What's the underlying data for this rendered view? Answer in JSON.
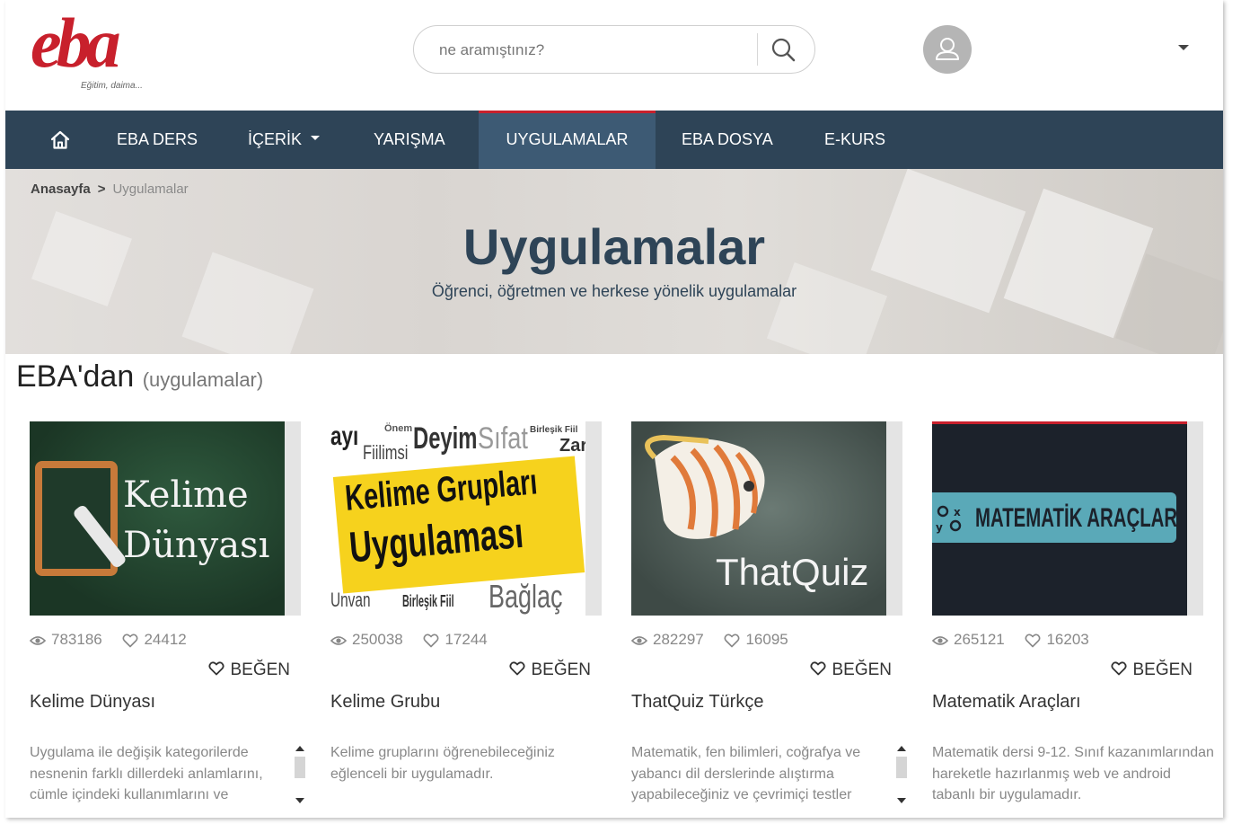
{
  "brand": {
    "logo_text": "eba",
    "tagline": "Eğitim, daima..."
  },
  "search": {
    "placeholder": "ne aramıştınız?"
  },
  "icons": {
    "home": "home-icon",
    "search": "search-icon",
    "user": "user-icon",
    "eye": "eye-icon",
    "heart": "heart-icon"
  },
  "colors": {
    "brand_red": "#c8202c",
    "nav_bg": "#2e4457",
    "nav_active": "#3d5a74"
  },
  "nav": {
    "items": [
      {
        "label": "EBA DERS"
      },
      {
        "label": "İÇERİK"
      },
      {
        "label": "YARIŞMA"
      },
      {
        "label": "UYGULAMALAR",
        "active": true
      },
      {
        "label": "EBA DOSYA"
      },
      {
        "label": "E-KURS"
      }
    ]
  },
  "breadcrumb": {
    "home": "Anasayfa",
    "separator": ">",
    "current": "Uygulamalar"
  },
  "hero": {
    "title": "Uygulamalar",
    "subtitle": "Öğrenci, öğretmen ve herkese yönelik uygulamalar"
  },
  "section": {
    "title": "EBA'dan",
    "subtitle": "(uygulamalar)"
  },
  "like_label": "BEĞEN",
  "cards": [
    {
      "thumb_text": [
        "Kelime",
        "Dünyası"
      ],
      "views": "783186",
      "likes": "24412",
      "title": "Kelime Dünyası",
      "description": "Uygulama ile değişik kategorilerde nesnenin farklı dillerdeki anlamlarını, cümle içindeki kullanımlarını ve"
    },
    {
      "thumb_text": [
        "Kelime Grupları",
        "Uygulaması"
      ],
      "thumb_bg_words": [
        "ayı",
        "Önem",
        "Deyim",
        "Sıfat",
        "Birleşik Fiil",
        "Zarf",
        "Fiilimsi",
        "Unvan",
        "Birleşik Fiil",
        "Bağlaç"
      ],
      "views": "250038",
      "likes": "17244",
      "title": "Kelime Grubu",
      "description": "Kelime gruplarını öğrenebileceğiniz eğlenceli bir uygulamadır."
    },
    {
      "thumb_text": [
        "ThatQuiz"
      ],
      "views": "282297",
      "likes": "16095",
      "title": "ThatQuiz Türkçe",
      "description": "Matematik, fen bilimleri, coğrafya ve yabancı dil derslerinde alıştırma yapabileceğiniz ve çevrimiçi testler"
    },
    {
      "thumb_text": [
        "MATEMATİK ARAÇLARI"
      ],
      "views": "265121",
      "likes": "16203",
      "title": "Matematik Araçları",
      "description": "Matematik dersi 9-12. Sınıf kazanımlarından hareketle hazırlanmış web ve android tabanlı bir uygulamadır."
    }
  ]
}
